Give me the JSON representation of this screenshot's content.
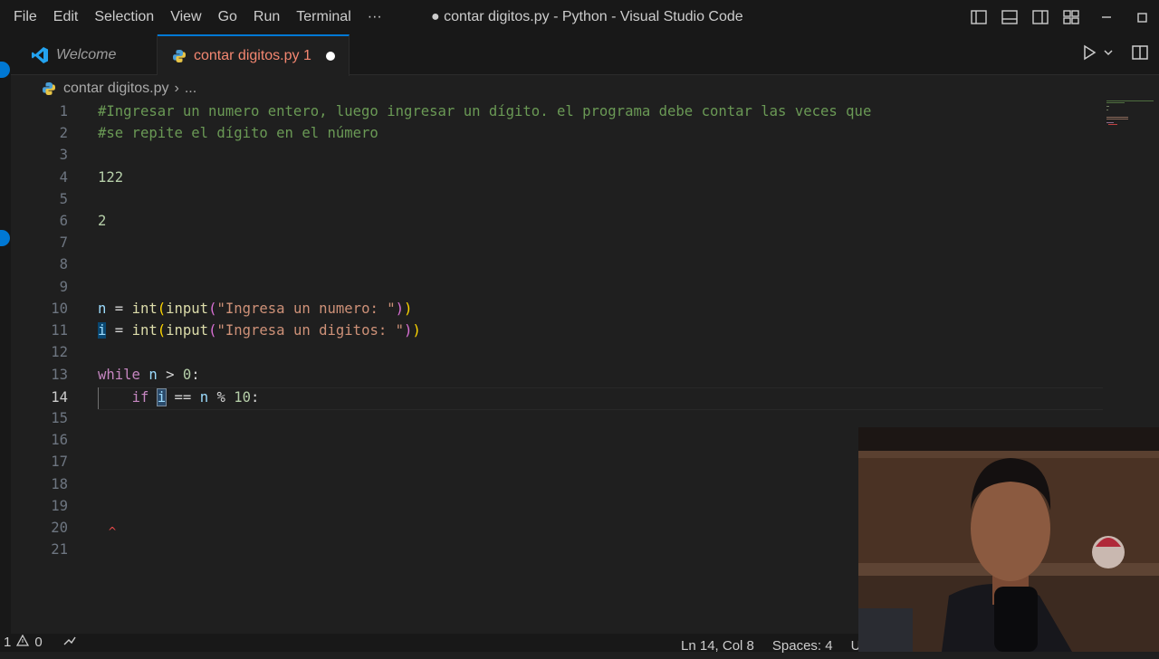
{
  "menu": [
    "File",
    "Edit",
    "Selection",
    "View",
    "Go",
    "Run",
    "Terminal",
    "···"
  ],
  "window_title": "● contar digitos.py - Python - Visual Studio Code",
  "tabs": [
    {
      "label": "Welcome"
    },
    {
      "label": "contar digitos.py 1"
    }
  ],
  "breadcrumb": {
    "file": "contar digitos.py",
    "sep": "›",
    "more": "..."
  },
  "editor": {
    "line_numbers": [
      "1",
      "2",
      "3",
      "4",
      "5",
      "6",
      "7",
      "8",
      "9",
      "10",
      "11",
      "12",
      "13",
      "14",
      "15",
      "16",
      "17",
      "18",
      "19",
      "20",
      "21"
    ],
    "active_line": "14",
    "code": {
      "l1": "#Ingresar un numero entero, luego ingresar un dígito. el programa debe contar las veces que",
      "l2": "#se repite el dígito en el número",
      "l4": "122",
      "l6": "2",
      "l10": {
        "var": "n",
        "eq": " = ",
        "fn1": "int",
        "p1": "(",
        "fn2": "input",
        "p2": "(",
        "str": "\"Ingresa un numero: \"",
        "p3": ")",
        "p4": ")"
      },
      "l11": {
        "var": "i",
        "eq": " = ",
        "fn1": "int",
        "p1": "(",
        "fn2": "input",
        "p2": "(",
        "str": "\"Ingresa un digitos: \"",
        "p3": ")",
        "p4": ")"
      },
      "l13": {
        "kw": "while",
        "sp": " ",
        "var": "n",
        "rest": " > ",
        "num": "0",
        "colon": ":"
      },
      "l14": {
        "indent": "    ",
        "kw": "if",
        "sp": " ",
        "var": "i",
        "op": " == ",
        "var2": "n",
        "mod": " % ",
        "num": "10",
        "colon": ":"
      }
    }
  },
  "status": {
    "problems_errors": "1",
    "problems_warnings": "0",
    "position": "Ln 14, Col 8",
    "spaces": "Spaces: 4",
    "encoding": "UT"
  }
}
